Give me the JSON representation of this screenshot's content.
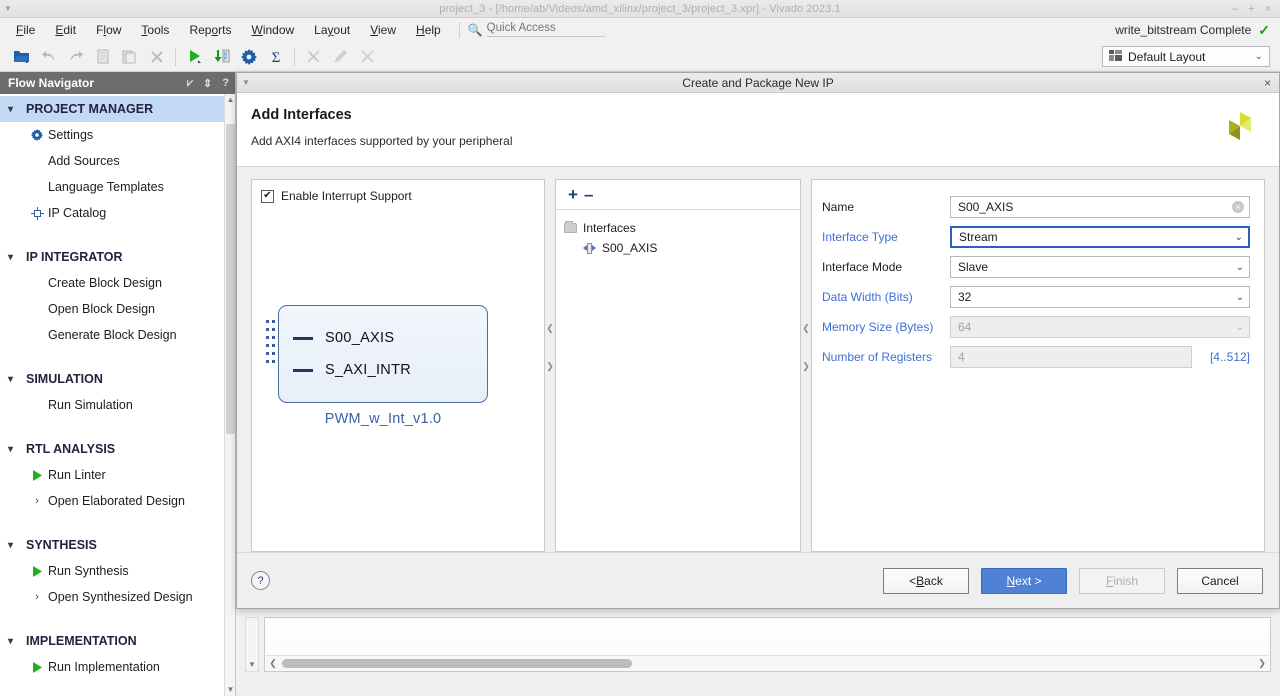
{
  "window": {
    "title": "project_3 - [/home/ab/Videos/amd_xilinx/project_3/project_3.xpr] - Vivado 2023.1",
    "minimize": "–",
    "maximize": "+",
    "close": "×"
  },
  "menubar": {
    "items": [
      {
        "label": "File"
      },
      {
        "label": "Edit"
      },
      {
        "label": "Flow"
      },
      {
        "label": "Tools"
      },
      {
        "label": "Reports"
      },
      {
        "label": "Window"
      },
      {
        "label": "Layout"
      },
      {
        "label": "View"
      },
      {
        "label": "Help"
      }
    ],
    "quick_access": {
      "icon": "search-icon",
      "placeholder": "Quick Access",
      "value": ""
    },
    "status": {
      "text": "write_bitstream Complete",
      "check": "✓",
      "check_color": "#16a016"
    }
  },
  "toolbar": {
    "buttons": [
      {
        "name": "open-project-icon",
        "enabled": true
      },
      {
        "name": "undo-icon",
        "enabled": false
      },
      {
        "name": "redo-icon",
        "enabled": false
      },
      {
        "name": "copy-icon",
        "enabled": false
      },
      {
        "name": "paste-icon",
        "enabled": false
      },
      {
        "name": "close-x-icon",
        "enabled": false
      },
      {
        "name": "run-play-icon",
        "enabled": true
      },
      {
        "name": "program-device-icon",
        "enabled": true
      },
      {
        "name": "settings-gear-icon",
        "enabled": true
      },
      {
        "name": "sigma-report-icon",
        "enabled": true
      },
      {
        "name": "no-route-icon",
        "enabled": false
      },
      {
        "name": "no-edit-icon",
        "enabled": false
      },
      {
        "name": "cut-icon",
        "enabled": false
      }
    ],
    "layout_select": {
      "label": "Default Layout",
      "icon": "layout-icon",
      "chevron": "⌄"
    }
  },
  "flow_navigator": {
    "title": "Flow Navigator",
    "header_icons": [
      {
        "name": "collapse-all-icon",
        "glyph": "⩗"
      },
      {
        "name": "expand-all-icon",
        "glyph": "⇕"
      },
      {
        "name": "help-icon",
        "glyph": "?"
      }
    ],
    "sections": [
      {
        "label": "PROJECT MANAGER",
        "selected": true,
        "twist": "⌄",
        "items": [
          {
            "label": "Settings",
            "icon": "gear-icon"
          },
          {
            "label": "Add Sources",
            "icon": ""
          },
          {
            "label": "Language Templates",
            "icon": ""
          },
          {
            "label": "IP Catalog",
            "icon": "ip-catalog-icon"
          }
        ]
      },
      {
        "label": "IP INTEGRATOR",
        "selected": false,
        "twist": "⌄",
        "items": [
          {
            "label": "Create Block Design",
            "icon": ""
          },
          {
            "label": "Open Block Design",
            "icon": ""
          },
          {
            "label": "Generate Block Design",
            "icon": ""
          }
        ]
      },
      {
        "label": "SIMULATION",
        "selected": false,
        "twist": "⌄",
        "items": [
          {
            "label": "Run Simulation",
            "icon": ""
          }
        ]
      },
      {
        "label": "RTL ANALYSIS",
        "selected": false,
        "twist": "⌄",
        "items": [
          {
            "label": "Run Linter",
            "icon": "play-icon"
          },
          {
            "label": "Open Elaborated Design",
            "icon": "chevron-right-icon"
          }
        ]
      },
      {
        "label": "SYNTHESIS",
        "selected": false,
        "twist": "⌄",
        "items": [
          {
            "label": "Run Synthesis",
            "icon": "play-icon"
          },
          {
            "label": "Open Synthesized Design",
            "icon": "chevron-right-icon"
          }
        ]
      },
      {
        "label": "IMPLEMENTATION",
        "selected": false,
        "twist": "⌄",
        "items": [
          {
            "label": "Run Implementation",
            "icon": "play-icon"
          }
        ]
      }
    ]
  },
  "dialog": {
    "title": "Create and Package New IP",
    "caret": "▼",
    "close": "×",
    "heading": "Add Interfaces",
    "subheading": "Add AXI4 interfaces supported by your peripheral",
    "logo": "amd-xilinx-logo",
    "left_panel": {
      "checkbox": {
        "label": "Enable Interrupt Support",
        "checked": true,
        "glyph": "✔"
      },
      "block": {
        "name": "PWM_w_Int_v1.0",
        "ports": [
          "S00_AXIS",
          "S_AXI_INTR"
        ]
      }
    },
    "mid_panel": {
      "add_icon": "+",
      "remove_icon": "–",
      "tree": {
        "root": "Interfaces",
        "children": [
          "S00_AXIS"
        ]
      }
    },
    "properties": [
      {
        "label": "Name",
        "label_link": false,
        "value": "S00_AXIS",
        "control": "text",
        "enabled": true,
        "focused": false,
        "clear_icon": "×"
      },
      {
        "label": "Interface Type",
        "label_link": true,
        "value": "Stream",
        "control": "select",
        "enabled": true,
        "focused": true
      },
      {
        "label": "Interface Mode",
        "label_link": false,
        "value": "Slave",
        "control": "select",
        "enabled": true,
        "focused": false
      },
      {
        "label": "Data Width (Bits)",
        "label_link": true,
        "value": "32",
        "control": "select",
        "enabled": true,
        "focused": false
      },
      {
        "label": "Memory Size (Bytes)",
        "label_link": true,
        "value": "64",
        "control": "select",
        "enabled": false,
        "focused": false
      },
      {
        "label": "Number of Registers",
        "label_link": true,
        "value": "4",
        "control": "text",
        "enabled": false,
        "focused": false,
        "range": "[4..512]"
      }
    ],
    "footer": {
      "help": "?",
      "buttons": [
        {
          "label": "< Back",
          "style": "normal",
          "name": "back-button"
        },
        {
          "label": "Next >",
          "style": "primary",
          "name": "next-button"
        },
        {
          "label": "Finish",
          "style": "disabled",
          "name": "finish-button"
        },
        {
          "label": "Cancel",
          "style": "normal",
          "name": "cancel-button"
        }
      ]
    }
  },
  "colors": {
    "accent": "#4f82d6",
    "link": "#3f6fd0",
    "selected_row": "#c3daf7",
    "success": "#16a016",
    "block_border": "#4a6fa5"
  }
}
